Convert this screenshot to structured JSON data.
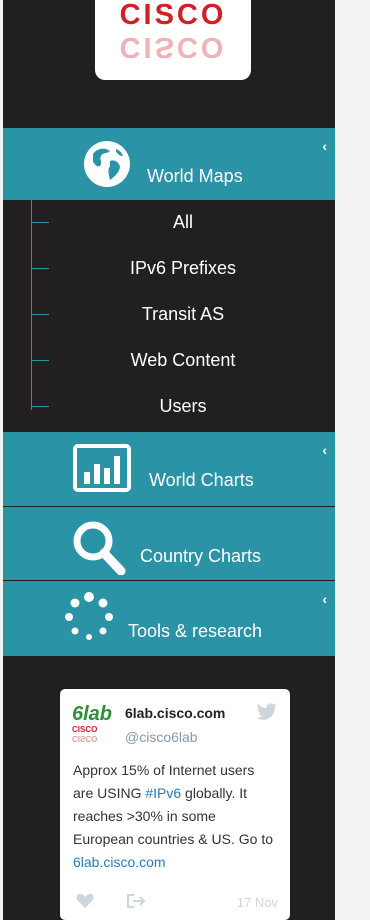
{
  "logo": {
    "text": "CISCO",
    "reflection": "CISCO"
  },
  "nav": {
    "world_maps": {
      "label": "World Maps",
      "chevron": "‹",
      "icon": "globe-icon"
    },
    "world_maps_items": [
      {
        "label": "All"
      },
      {
        "label": "IPv6 Prefixes"
      },
      {
        "label": "Transit AS"
      },
      {
        "label": "Web Content"
      },
      {
        "label": "Users"
      }
    ],
    "world_charts": {
      "label": "World Charts",
      "chevron": "‹",
      "icon": "bar-chart-icon"
    },
    "country_charts": {
      "label": "Country Charts",
      "icon": "search-icon"
    },
    "tools": {
      "label": "Tools & research",
      "chevron": "‹",
      "icon": "spinner-icon"
    }
  },
  "tweet": {
    "name": "6lab.cisco.com",
    "handle": "@cisco6lab",
    "logo_text": "6lab",
    "logo_subtext": "CISCO",
    "text_1": "Approx 15% of Internet users are USING ",
    "hashtag": "#IPv6",
    "text_2": " globally. It reaches >30% in some European countries & US. Go to ",
    "link": "6lab.cisco.com",
    "date": "17 Nov"
  },
  "colors": {
    "accent": "#2a93a6",
    "sidebar_bg": "#221f20",
    "cisco_red": "#d12027"
  }
}
